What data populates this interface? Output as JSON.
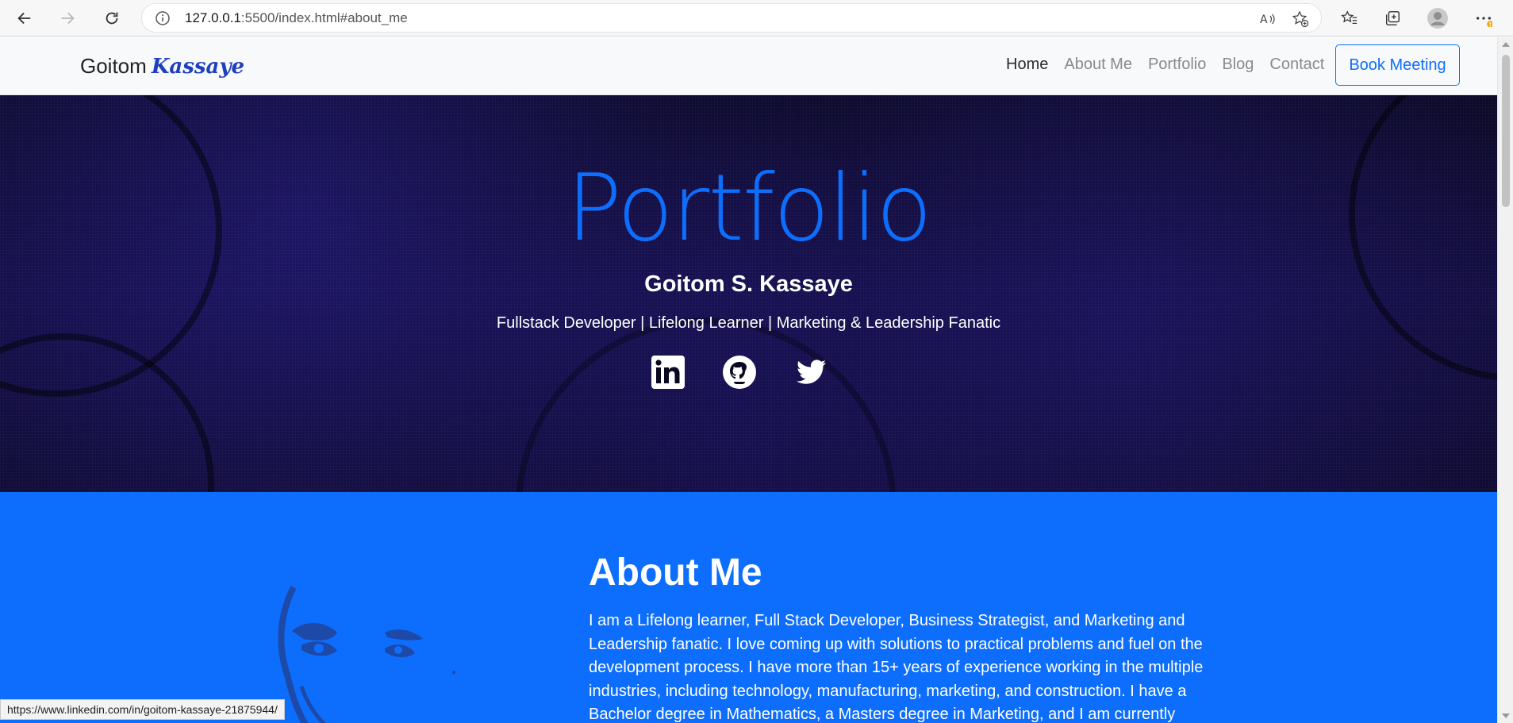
{
  "browser": {
    "url_host": "127.0.0.1",
    "url_rest": ":5500/index.html#about_me",
    "icons": [
      "back-arrow-icon",
      "forward-arrow-icon",
      "refresh-icon",
      "info-icon",
      "read-aloud-icon",
      "add-favorite-icon",
      "favorites-icon",
      "collections-icon",
      "profile-icon",
      "more-icon"
    ]
  },
  "navbar": {
    "brand_first": "Goitom",
    "brand_last": "Kassaye",
    "links": [
      {
        "label": "Home",
        "active": true
      },
      {
        "label": "About Me",
        "active": false
      },
      {
        "label": "Portfolio",
        "active": false
      },
      {
        "label": "Blog",
        "active": false
      },
      {
        "label": "Contact",
        "active": false
      }
    ],
    "cta": "Book Meeting"
  },
  "hero": {
    "title": "Portfolio",
    "name": "Goitom S. Kassaye",
    "tagline": "Fullstack Developer | Lifelong Learner | Marketing & Leadership Fanatic",
    "socials": [
      "linkedin-icon",
      "github-icon",
      "twitter-icon"
    ]
  },
  "about": {
    "title": "About Me",
    "text": "I am a Lifelong learner, Full Stack Developer, Business Strategist, and Marketing and Leadership fanatic. I love coming up with solutions to practical problems and fuel on the development process. I have more than 15+ years of experience working in the multiple industries, including technology, manufacturing, marketing, and construction. I have a Bachelor degree in Mathematics, a Masters degree in Marketing, and I am currently"
  },
  "status_url": "https://www.linkedin.com/in/goitom-kassaye-21875944/",
  "colors": {
    "accent": "#0d6efd",
    "hero_bg": "#0a0820",
    "nav_bg": "#f8f9fa"
  }
}
